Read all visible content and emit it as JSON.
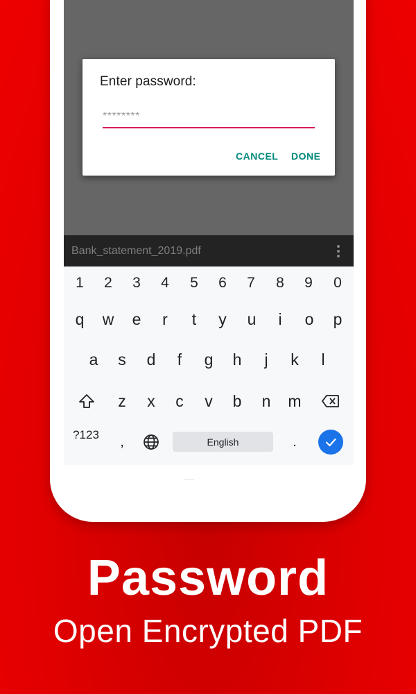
{
  "dialog": {
    "title": "Enter password:",
    "password_value": "********",
    "cancel_label": "CANCEL",
    "done_label": "DONE"
  },
  "file_bar": {
    "file_name": "Bank_statement_2019.pdf",
    "menu_icon": "more-vert-icon"
  },
  "keyboard": {
    "number_row": [
      "1",
      "2",
      "3",
      "4",
      "5",
      "6",
      "7",
      "8",
      "9",
      "0"
    ],
    "row1": [
      "q",
      "w",
      "e",
      "r",
      "t",
      "y",
      "u",
      "i",
      "o",
      "p"
    ],
    "row2": [
      "a",
      "s",
      "d",
      "f",
      "g",
      "h",
      "j",
      "k",
      "l"
    ],
    "row3": [
      "z",
      "x",
      "c",
      "v",
      "b",
      "n",
      "m"
    ],
    "symbols_label": "?123",
    "comma": ",",
    "period": ".",
    "space_label": "English",
    "shift_icon": "shift-icon",
    "backspace_icon": "backspace-icon",
    "globe_icon": "globe-icon",
    "enter_icon": "check-icon",
    "enter_color": "#1a73e8"
  },
  "promo": {
    "headline": "Password",
    "subline": "Open Encrypted PDF"
  },
  "colors": {
    "background": "#e00000",
    "input_underline": "#d81b60",
    "dialog_button": "#00897b"
  }
}
